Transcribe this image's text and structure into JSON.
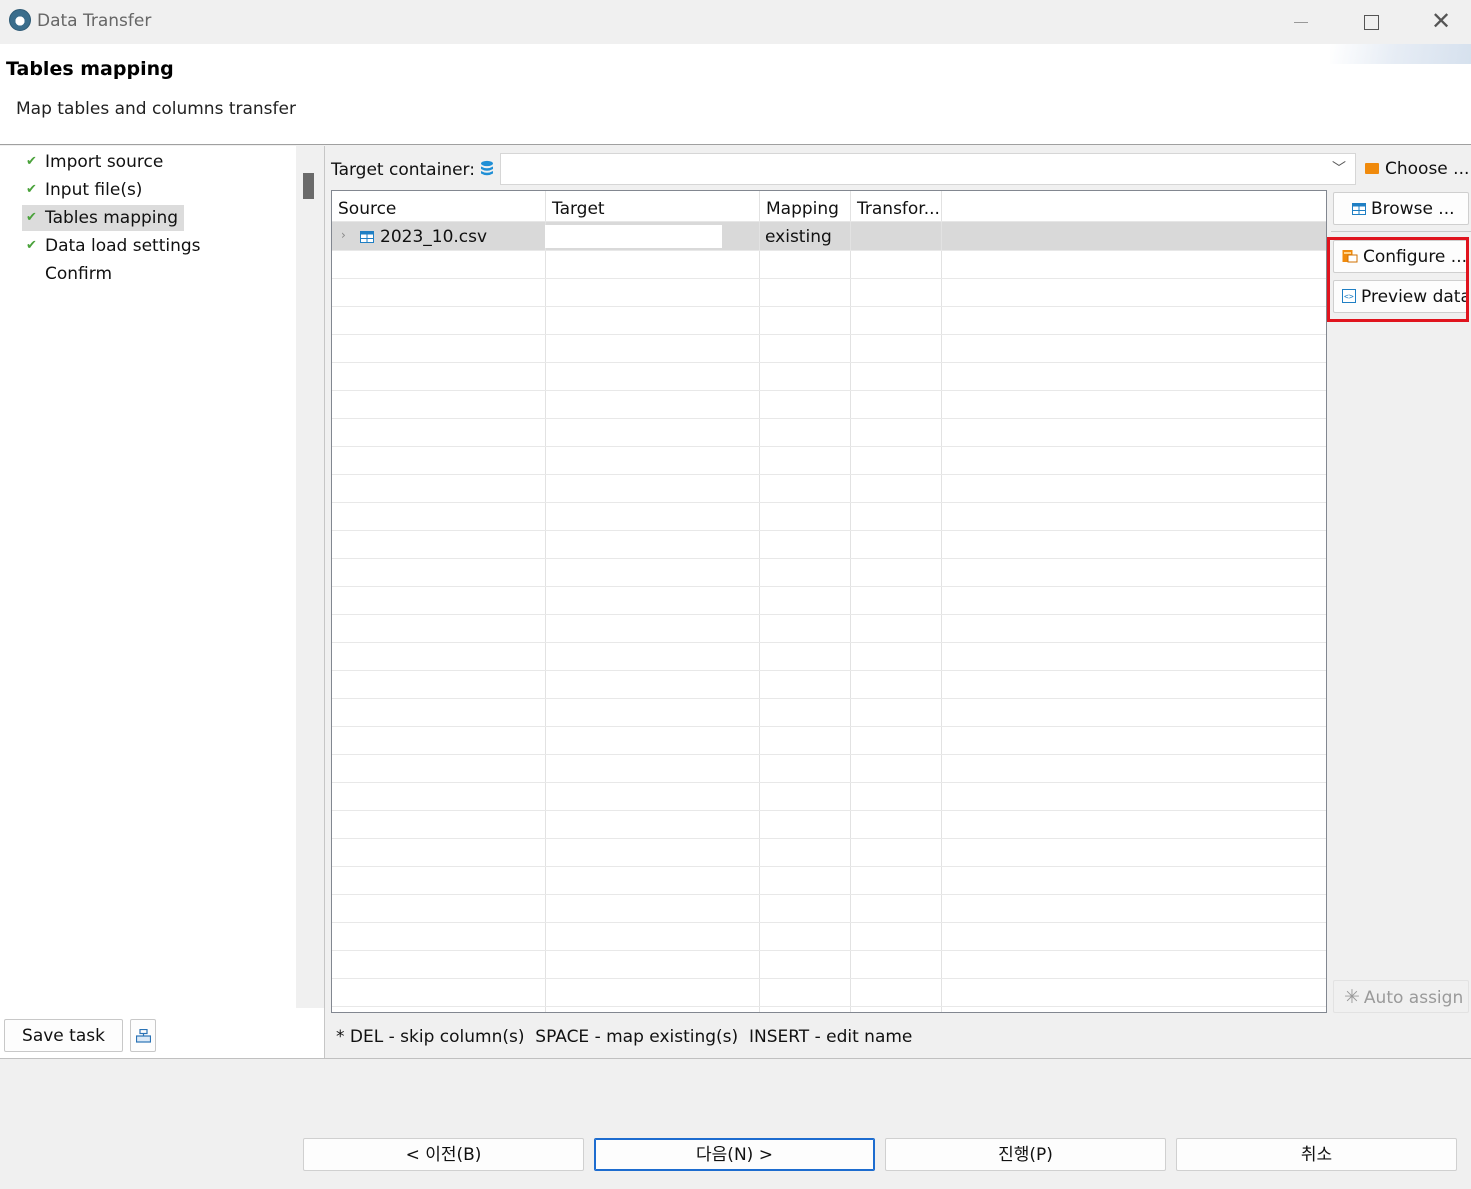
{
  "window": {
    "title": "Data Transfer"
  },
  "header": {
    "title": "Tables mapping",
    "description": "Map tables and columns transfer"
  },
  "steps": [
    {
      "label": "Import source",
      "done": true,
      "selected": false
    },
    {
      "label": "Input file(s)",
      "done": true,
      "selected": false
    },
    {
      "label": "Tables mapping",
      "done": true,
      "selected": true
    },
    {
      "label": "Data load settings",
      "done": true,
      "selected": false
    },
    {
      "label": "Confirm",
      "done": false,
      "selected": false
    }
  ],
  "left_footer": {
    "save_task_label": "Save task"
  },
  "target": {
    "label": "Target container:",
    "value": "",
    "choose_label": "Choose ..."
  },
  "table": {
    "columns": [
      "Source",
      "Target",
      "Mapping",
      "Transfor..."
    ],
    "rows": [
      {
        "source": "2023_10.csv",
        "target": "",
        "mapping": "existing",
        "transform": ""
      }
    ]
  },
  "side_buttons": {
    "browse": "Browse ...",
    "configure": "Configure ...",
    "preview": "Preview data",
    "auto_assign": "Auto assign"
  },
  "hint": "* DEL - skip column(s)  SPACE - map existing(s)  INSERT - edit name",
  "wizard_buttons": {
    "back": "< 이전(B)",
    "next": "다음(N) >",
    "finish": "진행(P)",
    "cancel": "취소"
  },
  "colors": {
    "check": "#4aa23b",
    "highlight": "#e0141e",
    "accent": "#1d6ccf",
    "folder": "#f08a0c"
  }
}
